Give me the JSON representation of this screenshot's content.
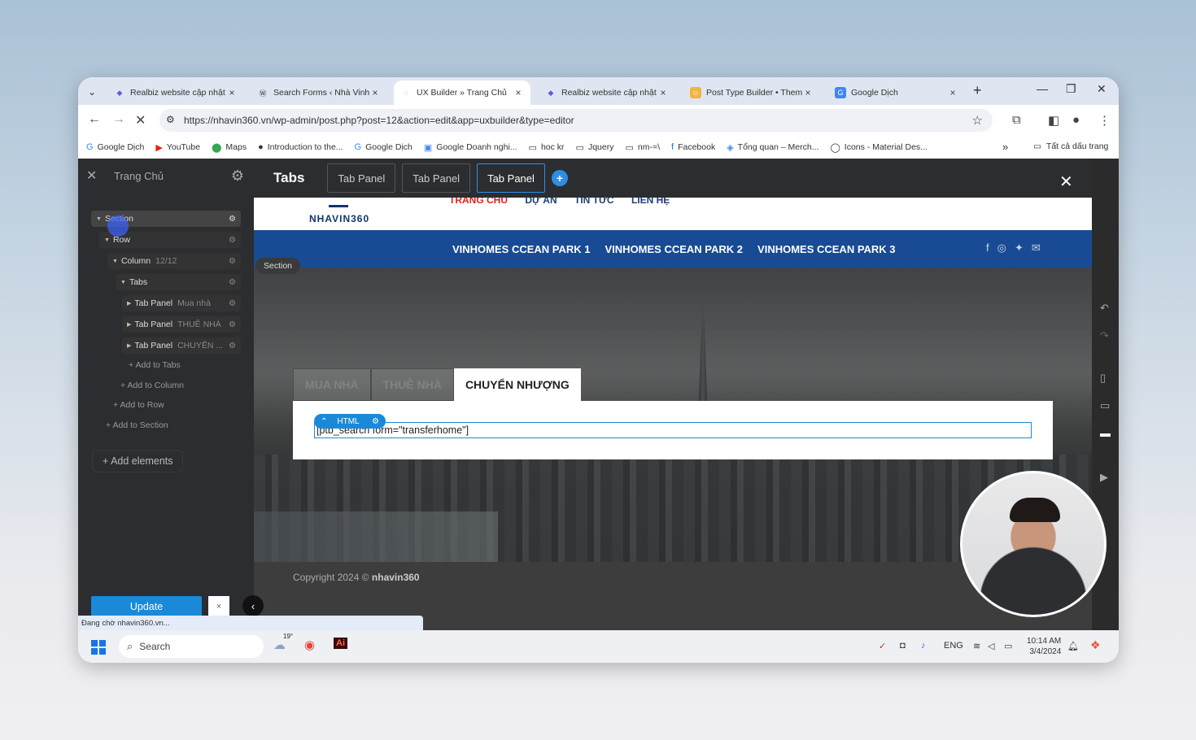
{
  "browser": {
    "tabs": [
      {
        "title": "Realbiz website cập nhật t",
        "icon": "realbiz-icon",
        "active": false
      },
      {
        "title": "Search Forms ‹ Nhà Vinho",
        "icon": "wordpress-icon",
        "active": false
      },
      {
        "title": "UX Builder » Trang Chủ",
        "icon": "loading-icon",
        "active": true
      },
      {
        "title": "Realbiz website cập nhật t",
        "icon": "realbiz-icon",
        "active": false
      },
      {
        "title": "Post Type Builder • Themi",
        "icon": "themi-icon",
        "active": false
      },
      {
        "title": "Google Dịch",
        "icon": "google-translate-icon",
        "active": false
      }
    ],
    "url": "https://nhavin360.vn/wp-admin/post.php?post=12&action=edit&app=uxbuilder&type=editor",
    "bookmarks": [
      {
        "label": "Google Dịch",
        "icon": "google-translate-icon"
      },
      {
        "label": "YouTube",
        "icon": "youtube-icon"
      },
      {
        "label": "Maps",
        "icon": "maps-icon"
      },
      {
        "label": "Introduction to the...",
        "icon": "globe-icon"
      },
      {
        "label": "Google Dịch",
        "icon": "google-translate-icon"
      },
      {
        "label": "Google Doanh nghi...",
        "icon": "business-icon"
      },
      {
        "label": "hoc kr",
        "icon": "folder-icon"
      },
      {
        "label": "Jquery",
        "icon": "folder-icon"
      },
      {
        "label": "nm-=\\",
        "icon": "folder-icon"
      },
      {
        "label": "Facebook",
        "icon": "facebook-icon"
      },
      {
        "label": "Tổng quan – Merch...",
        "icon": "merchant-icon"
      },
      {
        "label": "Icons - Material Des...",
        "icon": "material-icon"
      }
    ],
    "bookmarks_more": "»",
    "all_bookmarks": "Tất cả dấu trang"
  },
  "sidebar": {
    "title": "Trang Chủ",
    "tree": [
      {
        "label": "Section",
        "sub": "",
        "level": 0
      },
      {
        "label": "Row",
        "sub": "",
        "level": 1
      },
      {
        "label": "Column",
        "sub": "12/12",
        "level": 2
      },
      {
        "label": "Tabs",
        "sub": "",
        "level": 3
      },
      {
        "label": "Tab Panel",
        "sub": "Mua nhà",
        "level": 4
      },
      {
        "label": "Tab Panel",
        "sub": "THUÊ NHÀ",
        "level": 4
      },
      {
        "label": "Tab Panel",
        "sub": "CHUYỂN ...",
        "level": 4
      }
    ],
    "add_links": [
      "+ Add to Tabs",
      "+ Add to Column",
      "+ Add to Row",
      "+ Add to Section"
    ],
    "add_elements": "+ Add elements",
    "update": "Update",
    "small_close": "×"
  },
  "editor": {
    "title": "Tabs",
    "tab_panels": [
      "Tab Panel",
      "Tab Panel",
      "Tab Panel"
    ],
    "add": "+",
    "close": "✕"
  },
  "site": {
    "logo": "NHAVIN360",
    "top_nav": [
      "TRANG CHỦ",
      "DỰ ÁN",
      "TIN TỨC",
      "LIÊN HỆ"
    ],
    "menu": [
      "VINHOMES CCEAN PARK 1",
      "VINHOMES CCEAN PARK 2",
      "VINHOMES CCEAN PARK 3"
    ],
    "section_label": "Section",
    "tabs": [
      "MUA NHÀ",
      "THUÊ NHÀ",
      "CHUYỂN NHƯỢNG"
    ],
    "html_badge": "HTML",
    "html_content": "[ptb_search form=\"transferhome\"]",
    "copyright_prefix": "Copyright 2024 © ",
    "copyright_brand": "nhavin360"
  },
  "status_text": "Đang chờ nhavin360.vn...",
  "taskbar": {
    "search": "Search",
    "weather": "19°",
    "lang": "ENG",
    "time": "10:14 AM",
    "date": "3/4/2024"
  }
}
